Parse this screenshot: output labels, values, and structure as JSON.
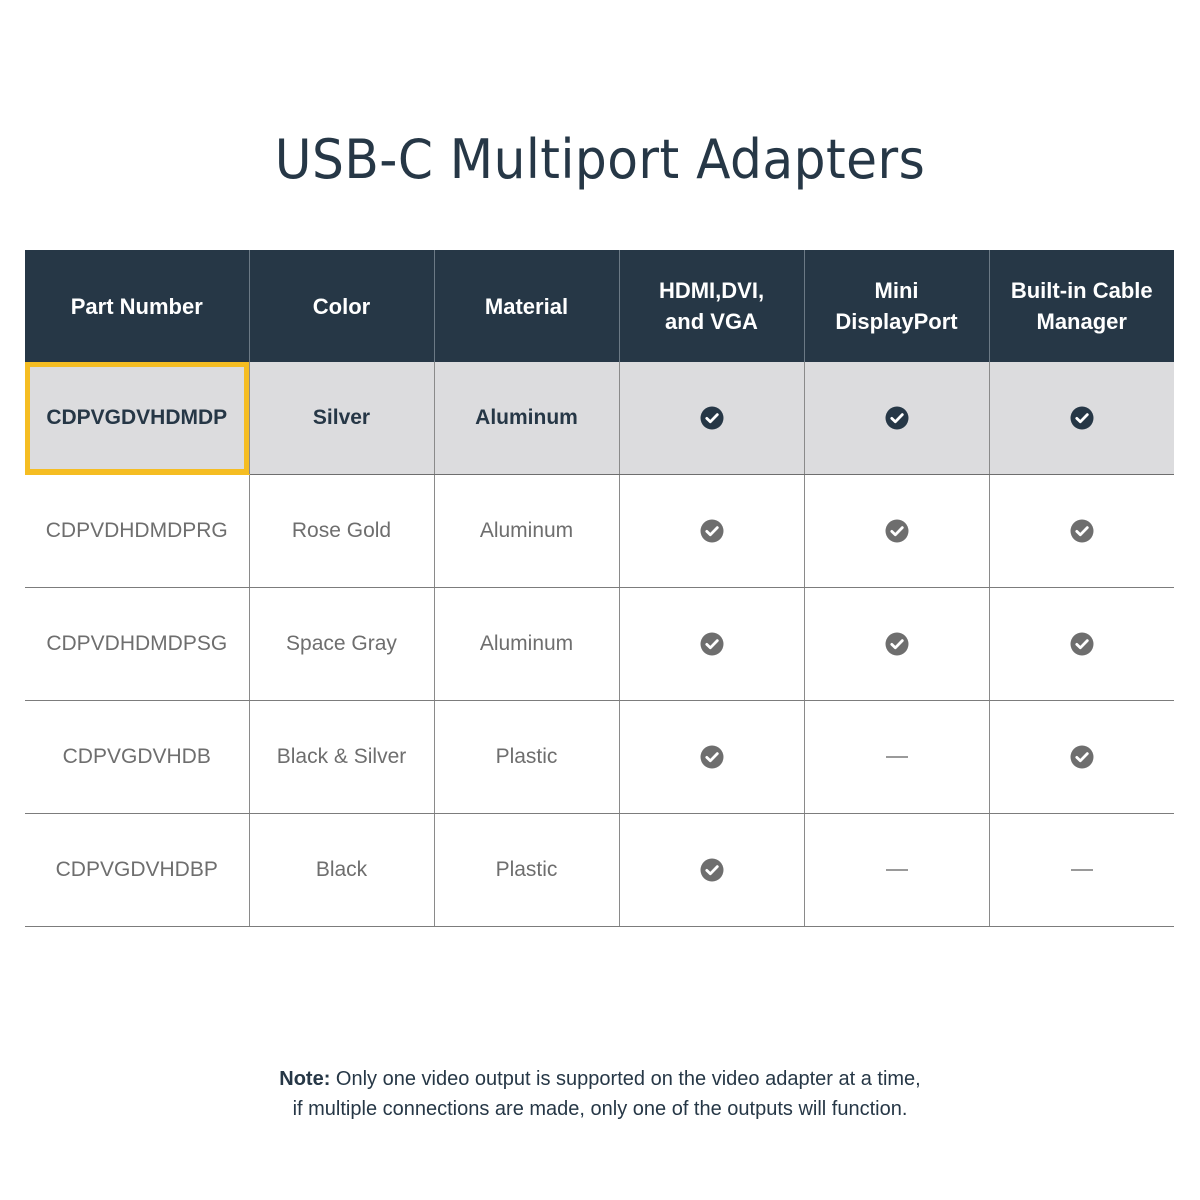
{
  "title": "USB-C Multiport Adapters",
  "table": {
    "headers": [
      "Part Number",
      "Color",
      "Material",
      "HDMI,DVI, and VGA",
      "Mini DisplayPort",
      "Built-in Cable Manager"
    ],
    "rows": [
      {
        "part_number": "CDPVGDVHDMDP",
        "color": "Silver",
        "material": "Aluminum",
        "hdmi_dvi_vga": true,
        "mini_displayport": true,
        "cable_manager": true,
        "highlighted": true
      },
      {
        "part_number": "CDPVDHDMDPRG",
        "color": "Rose Gold",
        "material": "Aluminum",
        "hdmi_dvi_vga": true,
        "mini_displayport": true,
        "cable_manager": true,
        "highlighted": false
      },
      {
        "part_number": "CDPVDHDMDPSG",
        "color": "Space Gray",
        "material": "Aluminum",
        "hdmi_dvi_vga": true,
        "mini_displayport": true,
        "cable_manager": true,
        "highlighted": false
      },
      {
        "part_number": "CDPVGDVHDB",
        "color": "Black & Silver",
        "material": "Plastic",
        "hdmi_dvi_vga": true,
        "mini_displayport": false,
        "cable_manager": true,
        "highlighted": false
      },
      {
        "part_number": "CDPVGDVHDBP",
        "color": "Black",
        "material": "Plastic",
        "hdmi_dvi_vga": true,
        "mini_displayport": false,
        "cable_manager": false,
        "highlighted": false
      }
    ],
    "icons": {
      "yes": "check-circle-icon",
      "no": "dash-icon"
    }
  },
  "note": {
    "label": "Note:",
    "line1": " Only one video output is supported on the video adapter at a time,",
    "line2": "if multiple connections are made, only one of the outputs will function."
  },
  "colors": {
    "header_bg": "#263746",
    "highlight_row_bg": "#dcdcde",
    "highlight_border": "#f5bd22",
    "check_featured": "#263746",
    "check_regular": "#6e6e6e",
    "body_text": "#6e6e6e"
  }
}
